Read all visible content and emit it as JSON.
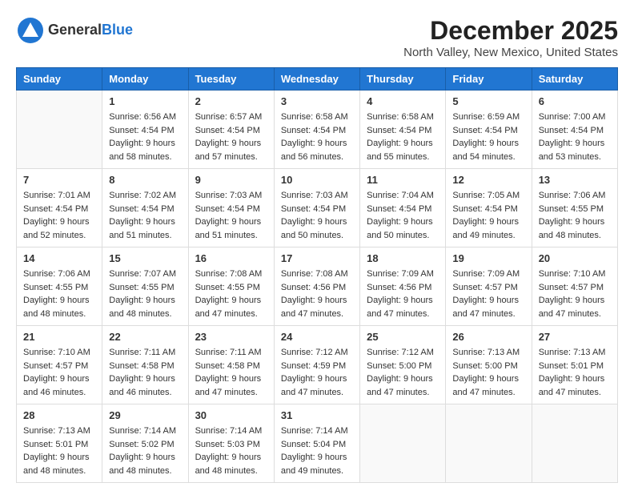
{
  "header": {
    "logo": {
      "general": "General",
      "blue": "Blue"
    },
    "title": "December 2025",
    "location": "North Valley, New Mexico, United States"
  },
  "weekdays": [
    "Sunday",
    "Monday",
    "Tuesday",
    "Wednesday",
    "Thursday",
    "Friday",
    "Saturday"
  ],
  "weeks": [
    [
      {
        "day": "",
        "info": ""
      },
      {
        "day": "1",
        "info": "Sunrise: 6:56 AM\nSunset: 4:54 PM\nDaylight: 9 hours\nand 58 minutes."
      },
      {
        "day": "2",
        "info": "Sunrise: 6:57 AM\nSunset: 4:54 PM\nDaylight: 9 hours\nand 57 minutes."
      },
      {
        "day": "3",
        "info": "Sunrise: 6:58 AM\nSunset: 4:54 PM\nDaylight: 9 hours\nand 56 minutes."
      },
      {
        "day": "4",
        "info": "Sunrise: 6:58 AM\nSunset: 4:54 PM\nDaylight: 9 hours\nand 55 minutes."
      },
      {
        "day": "5",
        "info": "Sunrise: 6:59 AM\nSunset: 4:54 PM\nDaylight: 9 hours\nand 54 minutes."
      },
      {
        "day": "6",
        "info": "Sunrise: 7:00 AM\nSunset: 4:54 PM\nDaylight: 9 hours\nand 53 minutes."
      }
    ],
    [
      {
        "day": "7",
        "info": "Sunrise: 7:01 AM\nSunset: 4:54 PM\nDaylight: 9 hours\nand 52 minutes."
      },
      {
        "day": "8",
        "info": "Sunrise: 7:02 AM\nSunset: 4:54 PM\nDaylight: 9 hours\nand 51 minutes."
      },
      {
        "day": "9",
        "info": "Sunrise: 7:03 AM\nSunset: 4:54 PM\nDaylight: 9 hours\nand 51 minutes."
      },
      {
        "day": "10",
        "info": "Sunrise: 7:03 AM\nSunset: 4:54 PM\nDaylight: 9 hours\nand 50 minutes."
      },
      {
        "day": "11",
        "info": "Sunrise: 7:04 AM\nSunset: 4:54 PM\nDaylight: 9 hours\nand 50 minutes."
      },
      {
        "day": "12",
        "info": "Sunrise: 7:05 AM\nSunset: 4:54 PM\nDaylight: 9 hours\nand 49 minutes."
      },
      {
        "day": "13",
        "info": "Sunrise: 7:06 AM\nSunset: 4:55 PM\nDaylight: 9 hours\nand 48 minutes."
      }
    ],
    [
      {
        "day": "14",
        "info": "Sunrise: 7:06 AM\nSunset: 4:55 PM\nDaylight: 9 hours\nand 48 minutes."
      },
      {
        "day": "15",
        "info": "Sunrise: 7:07 AM\nSunset: 4:55 PM\nDaylight: 9 hours\nand 48 minutes."
      },
      {
        "day": "16",
        "info": "Sunrise: 7:08 AM\nSunset: 4:55 PM\nDaylight: 9 hours\nand 47 minutes."
      },
      {
        "day": "17",
        "info": "Sunrise: 7:08 AM\nSunset: 4:56 PM\nDaylight: 9 hours\nand 47 minutes."
      },
      {
        "day": "18",
        "info": "Sunrise: 7:09 AM\nSunset: 4:56 PM\nDaylight: 9 hours\nand 47 minutes."
      },
      {
        "day": "19",
        "info": "Sunrise: 7:09 AM\nSunset: 4:57 PM\nDaylight: 9 hours\nand 47 minutes."
      },
      {
        "day": "20",
        "info": "Sunrise: 7:10 AM\nSunset: 4:57 PM\nDaylight: 9 hours\nand 47 minutes."
      }
    ],
    [
      {
        "day": "21",
        "info": "Sunrise: 7:10 AM\nSunset: 4:57 PM\nDaylight: 9 hours\nand 46 minutes."
      },
      {
        "day": "22",
        "info": "Sunrise: 7:11 AM\nSunset: 4:58 PM\nDaylight: 9 hours\nand 46 minutes."
      },
      {
        "day": "23",
        "info": "Sunrise: 7:11 AM\nSunset: 4:58 PM\nDaylight: 9 hours\nand 47 minutes."
      },
      {
        "day": "24",
        "info": "Sunrise: 7:12 AM\nSunset: 4:59 PM\nDaylight: 9 hours\nand 47 minutes."
      },
      {
        "day": "25",
        "info": "Sunrise: 7:12 AM\nSunset: 5:00 PM\nDaylight: 9 hours\nand 47 minutes."
      },
      {
        "day": "26",
        "info": "Sunrise: 7:13 AM\nSunset: 5:00 PM\nDaylight: 9 hours\nand 47 minutes."
      },
      {
        "day": "27",
        "info": "Sunrise: 7:13 AM\nSunset: 5:01 PM\nDaylight: 9 hours\nand 47 minutes."
      }
    ],
    [
      {
        "day": "28",
        "info": "Sunrise: 7:13 AM\nSunset: 5:01 PM\nDaylight: 9 hours\nand 48 minutes."
      },
      {
        "day": "29",
        "info": "Sunrise: 7:14 AM\nSunset: 5:02 PM\nDaylight: 9 hours\nand 48 minutes."
      },
      {
        "day": "30",
        "info": "Sunrise: 7:14 AM\nSunset: 5:03 PM\nDaylight: 9 hours\nand 48 minutes."
      },
      {
        "day": "31",
        "info": "Sunrise: 7:14 AM\nSunset: 5:04 PM\nDaylight: 9 hours\nand 49 minutes."
      },
      {
        "day": "",
        "info": ""
      },
      {
        "day": "",
        "info": ""
      },
      {
        "day": "",
        "info": ""
      }
    ]
  ]
}
